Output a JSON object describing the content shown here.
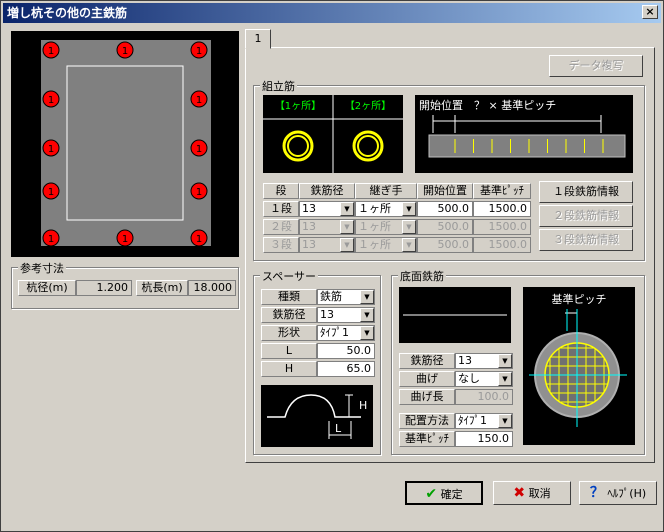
{
  "window": {
    "title": "増し杭その他の主鉄筋",
    "close": "×"
  },
  "tab": {
    "label": "1"
  },
  "data_copy_button": "データ複写",
  "reference": {
    "title": "参考寸法",
    "dia_label": "杭径(m)",
    "dia_value": "1.200",
    "len_label": "杭長(m)",
    "len_value": "18.000"
  },
  "pile_marker": "1",
  "kumitate": {
    "title": "組立筋",
    "ikkasho": "【1ヶ所】",
    "nikasho": "【2ヶ所】",
    "pitch_caption": "開始位置　？ × 基準ピッチ",
    "headers": [
      "段",
      "鉄筋径",
      "継ぎ手",
      "開始位置",
      "基準ﾋﾟｯﾁ"
    ],
    "rows": [
      {
        "dan": "１段",
        "dia": "13",
        "joint": "１ヶ所",
        "start": "500.0",
        "pitch": "1500.0"
      },
      {
        "dan": "２段",
        "dia": "13",
        "joint": "１ヶ所",
        "start": "500.0",
        "pitch": "1500.0"
      },
      {
        "dan": "３段",
        "dia": "13",
        "joint": "１ヶ所",
        "start": "500.0",
        "pitch": "1500.0"
      }
    ],
    "buttons": [
      "１段鉄筋情報",
      "２段鉄筋情報",
      "３段鉄筋情報"
    ]
  },
  "spacer": {
    "title": "スペーサー",
    "rows": [
      {
        "label": "種類",
        "value": "鉄筋",
        "type": "select"
      },
      {
        "label": "鉄筋径",
        "value": "13",
        "type": "select"
      },
      {
        "label": "形状",
        "value": "ﾀｲﾌﾟ1",
        "type": "select"
      },
      {
        "label": "L",
        "value": "50.0",
        "type": "input"
      },
      {
        "label": "H",
        "value": "65.0",
        "type": "input"
      }
    ],
    "h_label": "H",
    "l_label": "L"
  },
  "bottom": {
    "title": "底面鉄筋",
    "pitch_label": "基準ピッチ",
    "rows": [
      {
        "label": "鉄筋径",
        "value": "13",
        "type": "select"
      },
      {
        "label": "曲げ",
        "value": "なし",
        "type": "select"
      },
      {
        "label": "曲げ長",
        "value": "100.0",
        "type": "disabled"
      }
    ],
    "haichi_label": "配置方法",
    "haichi_value": "ﾀｲﾌﾟ1",
    "kijun_label": "基準ﾋﾟｯﾁ",
    "kijun_value": "150.0"
  },
  "footer": {
    "ok": "確定",
    "cancel": "取消",
    "help": "ﾍﾙﾌﾟ(H)"
  },
  "colors": {
    "marker": "#ff0000",
    "rebar": "#ffff00",
    "guide": "#00ffff"
  }
}
